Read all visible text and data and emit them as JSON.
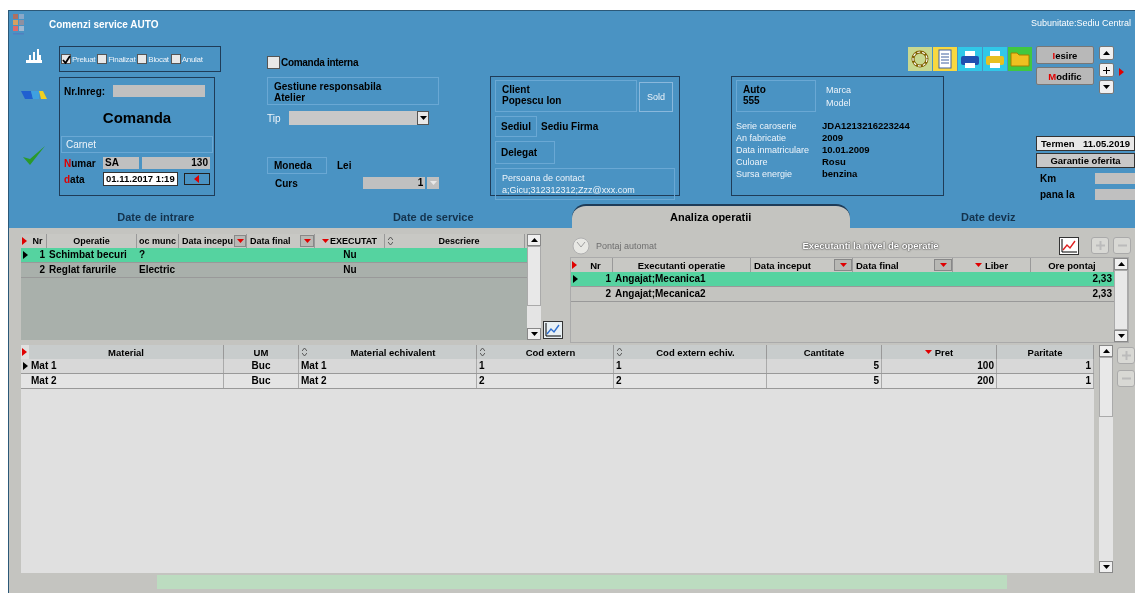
{
  "window": {
    "title": "Comenzi service AUTO",
    "subunit": "Subunitate:Sediu Central"
  },
  "status_checks": [
    {
      "label": "Preluat",
      "checked": true
    },
    {
      "label": "Finalizat",
      "checked": false
    },
    {
      "label": "Blocat",
      "checked": false
    },
    {
      "label": "Anulat",
      "checked": false
    }
  ],
  "order": {
    "nr_label": "Nr.Inreg:",
    "heading": "Comanda",
    "carnet_label": "Carnet",
    "numar_label": {
      "accel": "N",
      "rest": "umar"
    },
    "series": "SA",
    "number": "130",
    "date_label": {
      "accel": "d",
      "rest": "ata"
    },
    "date": "01.11.2017 1:19"
  },
  "internal_order": {
    "label": "Comanda interna",
    "checked": false
  },
  "gestiune": {
    "label": "Gestiune responsabila",
    "value": "Atelier"
  },
  "tip": {
    "label": "Tip"
  },
  "moneda": {
    "label": "Moneda",
    "value": "Lei"
  },
  "curs": {
    "label": "Curs",
    "value": "1"
  },
  "client": {
    "label": "Client",
    "name": "Popescu Ion",
    "sold": "Sold",
    "sediu_label": "Sediul",
    "sediu": "Sediu Firma",
    "delegat": "Delegat",
    "contact_label": "Persoana de contact",
    "contact": "a;Gicu;312312312;Zzz@xxx.com"
  },
  "auto": {
    "label": "Auto",
    "number": "555",
    "marca": "Marca",
    "model": "Model",
    "fields": [
      {
        "label": "Serie caroserie",
        "value": "JDA1213216223244"
      },
      {
        "label": "An fabricatie",
        "value": "2009"
      },
      {
        "label": "Data inmatriculare",
        "value": "10.01.2009"
      },
      {
        "label": "Culoare",
        "value": "Rosu"
      },
      {
        "label": "Sursa energie",
        "value": "benzina"
      }
    ]
  },
  "buttons": [
    {
      "accel": "I",
      "rest": "esire"
    },
    {
      "accel": "M",
      "rest": "odific"
    }
  ],
  "termen": {
    "label": "Termen",
    "value": "11.05.2019"
  },
  "garantie": "Garantie oferita",
  "km": {
    "label": "Km"
  },
  "pana_la": {
    "label": "pana la"
  },
  "tabs": [
    {
      "label": "Date de intrare",
      "selected": false
    },
    {
      "label": "Date de service",
      "selected": false
    },
    {
      "label": "Analiza operatii",
      "selected": true
    },
    {
      "label": "Date deviz",
      "selected": false
    }
  ],
  "operations": {
    "columns": [
      {
        "label": "Nr",
        "kind": "plain"
      },
      {
        "label": "Operatie",
        "kind": "plain"
      },
      {
        "label": "oc munc",
        "kind": "plain"
      },
      {
        "label": "Data incepu",
        "kind": "filter"
      },
      {
        "label": "Data final",
        "kind": "filter"
      },
      {
        "label": "EXECUTAT",
        "kind": "desc"
      },
      {
        "label": "Descriere",
        "kind": "sort"
      }
    ],
    "rows": [
      {
        "nr": "1",
        "operatie": "Schimbat becuri",
        "loc_munca": "?",
        "executat": "Nu",
        "selected": true
      },
      {
        "nr": "2",
        "operatie": "Reglat farurile",
        "loc_munca": "Electric",
        "executat": "Nu",
        "selected": false
      }
    ]
  },
  "executors": {
    "pontaj": "Pontaj automat",
    "title": "Executanti la nivel de operatie",
    "columns": [
      {
        "label": "Nr",
        "kind": "plain"
      },
      {
        "label": "Executanti operatie",
        "kind": "plain"
      },
      {
        "label": "Data inceput",
        "kind": "filter"
      },
      {
        "label": "Data final",
        "kind": "filter"
      },
      {
        "label": "Liber",
        "kind": "desc"
      },
      {
        "label": "Ore pontaj",
        "kind": "plain"
      }
    ],
    "rows": [
      {
        "nr": "1",
        "executant": "Angajat;Mecanica1",
        "ore": "2,33",
        "selected": true
      },
      {
        "nr": "2",
        "executant": "Angajat;Mecanica2",
        "ore": "2,33",
        "selected": false
      }
    ]
  },
  "materials": {
    "columns": [
      {
        "label": "Material",
        "kind": "plain"
      },
      {
        "label": "UM",
        "kind": "plain"
      },
      {
        "label": "Material echivalent",
        "kind": "sort"
      },
      {
        "label": "Cod extern",
        "kind": "sort"
      },
      {
        "label": "Cod extern echiv.",
        "kind": "sort"
      },
      {
        "label": "Cantitate",
        "kind": "plain"
      },
      {
        "label": "Pret",
        "kind": "desc"
      },
      {
        "label": "Paritate",
        "kind": "plain"
      }
    ],
    "rows": [
      {
        "material": "Mat 1",
        "um": "Buc",
        "echivalent": "Mat 1",
        "cod": "1",
        "cod_echiv": "1",
        "cantitate": "5",
        "pret": "100",
        "paritate": "1",
        "selected": true
      },
      {
        "material": "Mat 2",
        "um": "Buc",
        "echivalent": "Mat 2",
        "cod": "2",
        "cod_echiv": "2",
        "cantitate": "5",
        "pret": "200",
        "paritate": "1",
        "selected": false
      }
    ]
  }
}
